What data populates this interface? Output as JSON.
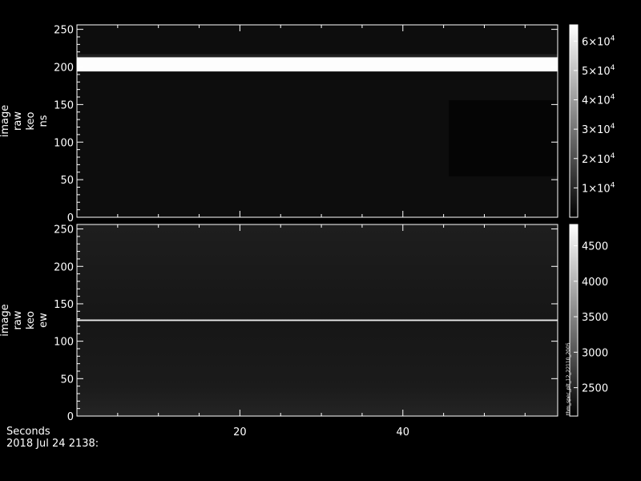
{
  "footer": {
    "x_axis_label": "Seconds",
    "date_label": "2018 Jul 24 2138:"
  },
  "side_credit": "thm_spec_plt_12_22110_2005",
  "chart_data": [
    {
      "type": "heatmap",
      "ylabel_lines": [
        "image",
        "raw",
        "keo",
        "ns"
      ],
      "xlim": [
        0,
        59
      ],
      "ylim": [
        0,
        256
      ],
      "yticks": [
        0,
        50,
        100,
        150,
        200,
        250
      ],
      "xticks": [
        20,
        40
      ],
      "colorbar": {
        "range": [
          0,
          65535
        ],
        "ticks": [
          {
            "value": 10000,
            "mantissa": "1",
            "exponent": "4"
          },
          {
            "value": 20000,
            "mantissa": "2",
            "exponent": "4"
          },
          {
            "value": 30000,
            "mantissa": "3",
            "exponent": "4"
          },
          {
            "value": 40000,
            "mantissa": "4",
            "exponent": "4"
          },
          {
            "value": 50000,
            "mantissa": "5",
            "exponent": "4"
          },
          {
            "value": 60000,
            "mantissa": "6",
            "exponent": "4"
          }
        ]
      },
      "bands": [
        {
          "y0": 194,
          "y1": 213,
          "x0": 0,
          "x1": 59,
          "level": 65000
        },
        {
          "y0": 213,
          "y1": 217,
          "x0": 0,
          "x1": 59,
          "level": 8000
        }
      ],
      "background_level": 2500
    },
    {
      "type": "heatmap",
      "ylabel_lines": [
        "image",
        "raw",
        "keo",
        "ew"
      ],
      "xlim": [
        0,
        59
      ],
      "ylim": [
        0,
        256
      ],
      "yticks": [
        0,
        50,
        100,
        150,
        200,
        250
      ],
      "xticks": [
        20,
        40
      ],
      "colorbar": {
        "range": [
          2100,
          4800
        ],
        "ticks": [
          {
            "value": 2500,
            "label": "2500"
          },
          {
            "value": 3000,
            "label": "3000"
          },
          {
            "value": 3500,
            "label": "3500"
          },
          {
            "value": 4000,
            "label": "4000"
          },
          {
            "value": 4500,
            "label": "4500"
          }
        ]
      },
      "bands": [
        {
          "y0": 127,
          "y1": 129,
          "x0": 0,
          "x1": 59,
          "level": 4600
        }
      ],
      "background_level": 2550
    }
  ]
}
